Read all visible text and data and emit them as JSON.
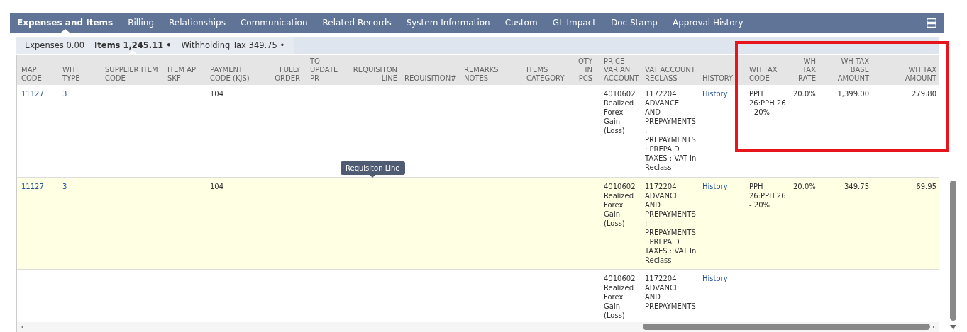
{
  "tabs": [
    {
      "label": "Expenses and Items",
      "selected": true
    },
    {
      "label": "Billing",
      "selected": false
    },
    {
      "label": "Relationships",
      "selected": false
    },
    {
      "label": "Communication",
      "selected": false
    },
    {
      "label": "Related Records",
      "selected": false
    },
    {
      "label": "System Information",
      "selected": false
    },
    {
      "label": "Custom",
      "selected": false
    },
    {
      "label": "GL Impact",
      "selected": false
    },
    {
      "label": "Doc Stamp",
      "selected": false
    },
    {
      "label": "Approval History",
      "selected": false
    }
  ],
  "subtabs": [
    {
      "label": "Expenses 0.00",
      "selected": false
    },
    {
      "label": "Items 1,245.11 •",
      "selected": true
    },
    {
      "label": "Withholding Tax 349.75 •",
      "selected": false
    }
  ],
  "table": {
    "columns": [
      {
        "label": "MAP CODE",
        "kind": "link"
      },
      {
        "label": "WHT TYPE",
        "kind": "link"
      },
      {
        "label": "SUPPLIER ITEM CODE",
        "kind": "text"
      },
      {
        "label": "ITEM AP SKF",
        "kind": "text"
      },
      {
        "label": "PAYMENT CODE (KJS)",
        "kind": "text"
      },
      {
        "label": "FULLY ORDER",
        "kind": "text"
      },
      {
        "label": "TO UPDATE PR",
        "kind": "text"
      },
      {
        "label": "REQUISITON LINE",
        "kind": "text"
      },
      {
        "label": "REQUISITION#",
        "kind": "text"
      },
      {
        "label": "REMARKS NOTES",
        "kind": "text"
      },
      {
        "label": "ITEMS CATEGORY",
        "kind": "text"
      },
      {
        "label": "QTY IN PCS",
        "kind": "text"
      },
      {
        "label": "PRICE VARIAN ACCOUNT",
        "kind": "text"
      },
      {
        "label": "VAT ACCOUNT RECLASS",
        "kind": "text"
      },
      {
        "label": "HISTORY",
        "kind": "link"
      },
      {
        "label": "WH TAX CODE",
        "kind": "text"
      },
      {
        "label": "WH TAX RATE",
        "kind": "text"
      },
      {
        "label": "WH TAX BASE AMOUNT",
        "kind": "number"
      },
      {
        "label": "WH TAX AMOUNT",
        "kind": "number"
      }
    ],
    "rows": [
      {
        "selected": false,
        "cells": [
          "11127",
          "3",
          null,
          null,
          "104",
          null,
          null,
          null,
          null,
          null,
          null,
          null,
          "4010602 Realized Forex Gain (Loss)",
          "1172204 ADVANCE AND PREPAYMENTS : PREPAYMENTS : PREPAID TAXES : VAT In Reclass",
          "History",
          "PPH 26:PPH 26 - 20%",
          "20.0%",
          "1,399.00",
          "279.80"
        ]
      },
      {
        "selected": true,
        "cells": [
          "11127",
          "3",
          null,
          null,
          "104",
          null,
          null,
          null,
          null,
          null,
          null,
          null,
          "4010602 Realized Forex Gain (Loss)",
          "1172204 ADVANCE AND PREPAYMENTS : PREPAYMENTS : PREPAID TAXES : VAT In Reclass",
          "History",
          "PPH 26:PPH 26 - 20%",
          "20.0%",
          "349.75",
          "69.95"
        ]
      },
      {
        "selected": false,
        "cells": [
          null,
          null,
          null,
          null,
          null,
          null,
          null,
          null,
          null,
          null,
          null,
          null,
          "4010602 Realized Forex Gain (Loss)",
          "1172204 ADVANCE AND PREPAYMENTS",
          "History",
          null,
          null,
          null,
          null
        ]
      }
    ]
  },
  "tooltip": {
    "text": "Requisiton Line"
  }
}
